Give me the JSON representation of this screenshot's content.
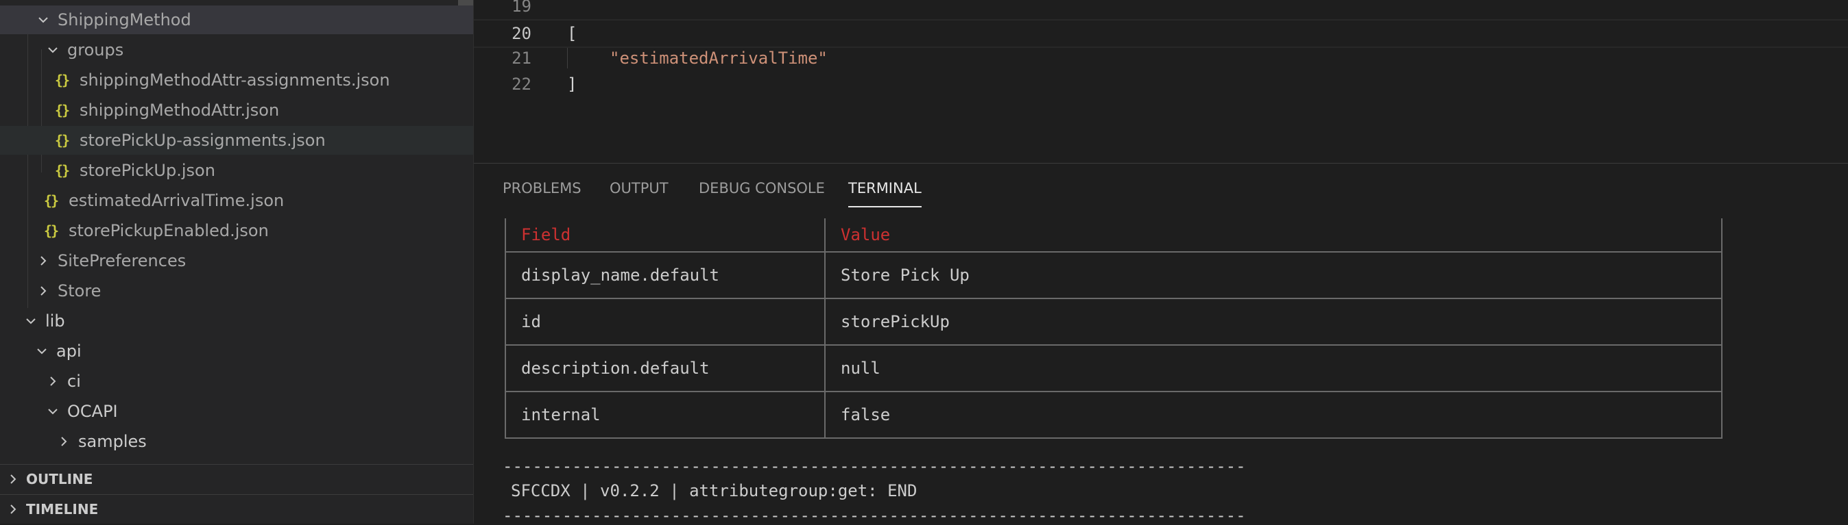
{
  "explorer": {
    "items": [
      {
        "label": "ShippingMethod",
        "type": "folder",
        "expanded": true
      },
      {
        "label": "groups",
        "type": "folder",
        "expanded": true
      },
      {
        "label": "shippingMethodAttr-assignments.json",
        "type": "json"
      },
      {
        "label": "shippingMethodAttr.json",
        "type": "json"
      },
      {
        "label": "storePickUp-assignments.json",
        "type": "json"
      },
      {
        "label": "storePickUp.json",
        "type": "json"
      },
      {
        "label": "estimatedArrivalTime.json",
        "type": "json"
      },
      {
        "label": "storePickupEnabled.json",
        "type": "json"
      },
      {
        "label": "SitePreferences",
        "type": "folder",
        "expanded": false
      },
      {
        "label": "Store",
        "type": "folder",
        "expanded": false
      },
      {
        "label": "lib",
        "type": "folder",
        "expanded": true
      },
      {
        "label": "api",
        "type": "folder",
        "expanded": true
      },
      {
        "label": "ci",
        "type": "folder",
        "expanded": false
      },
      {
        "label": "OCAPI",
        "type": "folder",
        "expanded": true
      },
      {
        "label": "samples",
        "type": "folder",
        "expanded": false
      }
    ],
    "json_icon": "{}",
    "outline_label": "OUTLINE",
    "timeline_label": "TIMELINE"
  },
  "editor": {
    "lines": [
      {
        "number": "19",
        "text": ""
      },
      {
        "number": "20",
        "text": "["
      },
      {
        "number": "21",
        "text": "\"estimatedArrivalTime\""
      },
      {
        "number": "22",
        "text": "]"
      }
    ],
    "current_line": "20"
  },
  "panel": {
    "tabs": [
      "PROBLEMS",
      "OUTPUT",
      "DEBUG CONSOLE",
      "TERMINAL"
    ],
    "active_tab": "TERMINAL"
  },
  "terminal": {
    "table_header": {
      "field": "Field",
      "value": "Value"
    },
    "rows": [
      {
        "field": "display_name.default",
        "value": "Store Pick Up"
      },
      {
        "field": "id",
        "value": "storePickUp"
      },
      {
        "field": "description.default",
        "value": "null"
      },
      {
        "field": "internal",
        "value": "false"
      }
    ],
    "separator": "---------------------------------------------------------------------------",
    "status_line": "SFCCDX | v0.2.2 | attributegroup:get: END"
  },
  "colors": {
    "sidebar_bg": "#252526",
    "editor_bg": "#1e1e1e",
    "json_icon": "#cbcb41",
    "string": "#ce9178",
    "table_header": "#cd3131"
  }
}
